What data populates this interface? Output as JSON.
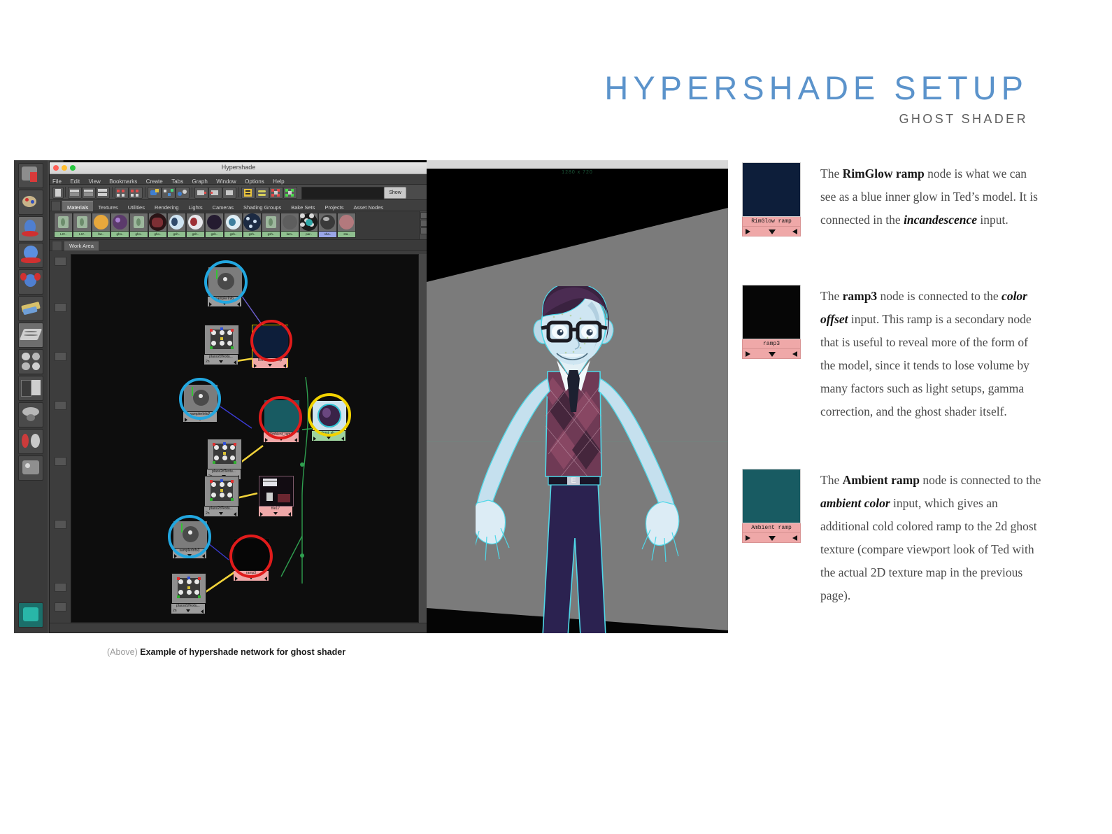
{
  "header": {
    "title": "HYPERSHADE SETUP",
    "subtitle": "GHOST SHADER"
  },
  "caption": {
    "prefix": "(Above)",
    "text": "Example of hypershade network for ghost shader"
  },
  "colors": {
    "title_blue": "#5b93cb",
    "rimglow_navy": "#0d1e3a",
    "ramp3_black": "#060606",
    "ambient_teal": "#185b62",
    "node_label_pink": "#efa8a8",
    "highlight_blue": "#22a7e0",
    "highlight_red": "#e01b1b",
    "highlight_yellow": "#f2d300"
  },
  "hypershade": {
    "window_title": "Hypershade",
    "menus": [
      "File",
      "Edit",
      "View",
      "Bookmarks",
      "Create",
      "Tabs",
      "Graph",
      "Window",
      "Options",
      "Help"
    ],
    "toolbar": {
      "search_value": "",
      "show_label": "Show"
    },
    "tabs": [
      {
        "label": "Materials",
        "active": true
      },
      {
        "label": "Textures",
        "active": false
      },
      {
        "label": "Utilities",
        "active": false
      },
      {
        "label": "Rendering",
        "active": false
      },
      {
        "label": "Lights",
        "active": false
      },
      {
        "label": "Cameras",
        "active": false
      },
      {
        "label": "Shading Groups",
        "active": false
      },
      {
        "label": "Bake Sets",
        "active": false
      },
      {
        "label": "Projects",
        "active": false
      },
      {
        "label": "Asset Nodes",
        "active": false
      }
    ],
    "material_swatches": [
      {
        "label": "LIV..",
        "type": "lambert-green",
        "selected": false
      },
      {
        "label": "LIV..",
        "type": "lambert-green",
        "selected": false
      },
      {
        "label": "fac..",
        "type": "orange-disc",
        "selected": false
      },
      {
        "label": "gho..",
        "type": "purple-ball",
        "selected": false
      },
      {
        "label": "gho..",
        "type": "lambert-green",
        "selected": false
      },
      {
        "label": "gho..",
        "type": "dark-red",
        "selected": false
      },
      {
        "label": "gsh..",
        "type": "blue-white",
        "selected": false
      },
      {
        "label": "gsh..",
        "type": "red-white",
        "selected": false
      },
      {
        "label": "gsh..",
        "type": "dark-navy",
        "selected": false
      },
      {
        "label": "gsh..",
        "type": "cyan-white",
        "selected": false
      },
      {
        "label": "gsh..",
        "type": "noise",
        "selected": false
      },
      {
        "label": "gsh..",
        "type": "lambert-green",
        "selected": false
      },
      {
        "label": "lam..",
        "type": "gray-ball",
        "selected": false
      },
      {
        "label": "par..",
        "type": "checker",
        "selected": false
      },
      {
        "label": "sha..",
        "type": "dark-ball",
        "selected": true
      },
      {
        "label": "sta..",
        "type": "maroon-ball",
        "selected": false
      }
    ],
    "work_area_tab": "Work Area",
    "graph_nodes": [
      {
        "id": "n1",
        "label": "samplerInfo",
        "kind": "samplerinfo",
        "highlight": "blue"
      },
      {
        "id": "n2",
        "label": "place2dTextu...",
        "kind": "place2d",
        "highlight": "none"
      },
      {
        "id": "n3",
        "label": "RimGlow_ramp",
        "kind": "ramp",
        "swatch": "#0d1e3a",
        "highlight": "red",
        "selected": true
      },
      {
        "id": "n4",
        "label": "samplerInfo2",
        "kind": "samplerinfo",
        "highlight": "blue"
      },
      {
        "id": "n5",
        "label": "place2dTextu...",
        "kind": "place2d",
        "highlight": "none"
      },
      {
        "id": "n6",
        "label": "Ambient_ramp",
        "kind": "ramp",
        "swatch": "#185b62",
        "highlight": "red"
      },
      {
        "id": "n7",
        "label": "ghost_sh...",
        "kind": "shader-ball",
        "highlight": "yellow"
      },
      {
        "id": "n8",
        "label": "place2dTextu...",
        "kind": "place2d",
        "highlight": "none"
      },
      {
        "id": "n9",
        "label": "file17",
        "kind": "file",
        "highlight": "none"
      },
      {
        "id": "n10",
        "label": "samplerInfo3",
        "kind": "samplerinfo",
        "highlight": "blue"
      },
      {
        "id": "n11",
        "label": "ramp3",
        "kind": "ramp",
        "swatch": "#060606",
        "highlight": "red"
      },
      {
        "id": "n12",
        "label": "place2dTextu...",
        "kind": "place2d",
        "highlight": "none"
      }
    ]
  },
  "viewport": {
    "resolution_gate": "1280 x 720",
    "character_name": "Ted"
  },
  "notes": [
    {
      "swatch_label": "RimGlow ramp",
      "swatch_color": "#0d1e3a",
      "segments": [
        {
          "t": "The ",
          "s": "plain"
        },
        {
          "t": "RimGlow ramp",
          "s": "bold"
        },
        {
          "t": " node is what we can see as a blue inner glow in Ted’s model. It is connected in the ",
          "s": "plain"
        },
        {
          "t": "incandescence",
          "s": "bolditalic"
        },
        {
          "t": " input.",
          "s": "plain"
        }
      ]
    },
    {
      "swatch_label": "ramp3",
      "swatch_color": "#060606",
      "segments": [
        {
          "t": "The ",
          "s": "plain"
        },
        {
          "t": "ramp3",
          "s": "bold"
        },
        {
          "t": " node is connected to the ",
          "s": "plain"
        },
        {
          "t": "color offset",
          "s": "bolditalic"
        },
        {
          "t": " input. This ramp is a secondary node that is useful to reveal more of the form of the model, since it tends to lose volume by many factors such as light setups, gamma correction, and the ghost shader itself.",
          "s": "plain"
        }
      ]
    },
    {
      "swatch_label": "Ambient ramp",
      "swatch_color": "#185b62",
      "segments": [
        {
          "t": "The ",
          "s": "plain"
        },
        {
          "t": "Ambient ramp",
          "s": "bold"
        },
        {
          "t": " node is connected to the ",
          "s": "plain"
        },
        {
          "t": "ambient color",
          "s": "bolditalic"
        },
        {
          "t": " input, which gives an additional cold colored ramp to the 2d ghost texture (compare viewport look of Ted with the actual 2D texture map in the previous page).",
          "s": "plain"
        }
      ]
    }
  ]
}
